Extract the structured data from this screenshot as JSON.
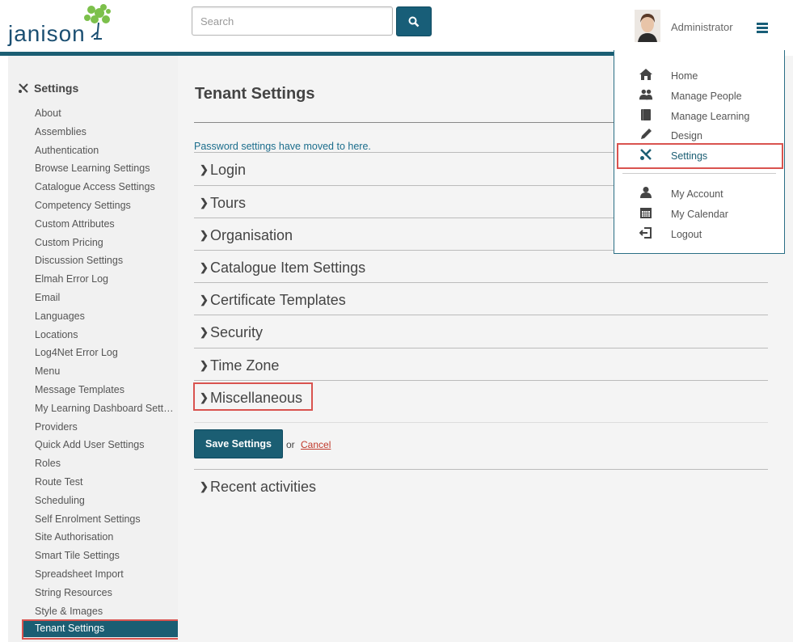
{
  "header": {
    "logo_text": "Janison",
    "search_placeholder": "Search",
    "user_name": "Administrator"
  },
  "sidebar": {
    "title": "Settings",
    "items": [
      "About",
      "Assemblies",
      "Authentication",
      "Browse Learning Settings",
      "Catalogue Access Settings",
      "Competency Settings",
      "Custom Attributes",
      "Custom Pricing",
      "Discussion Settings",
      "Elmah Error Log",
      "Email",
      "Languages",
      "Locations",
      "Log4Net Error Log",
      "Menu",
      "Message Templates",
      "My Learning Dashboard Setti...",
      "Providers",
      "Quick Add User Settings",
      "Roles",
      "Route Test",
      "Scheduling",
      "Self Enrolment Settings",
      "Site Authorisation",
      "Smart Tile Settings",
      "Spreadsheet Import",
      "String Resources",
      "Style & Images"
    ],
    "active_item": "Tenant Settings"
  },
  "main": {
    "title": "Tenant Settings",
    "password_link": "Password settings have moved to here.",
    "sections": [
      "Login",
      "Tours",
      "Organisation",
      "Catalogue Item Settings",
      "Certificate Templates",
      "Security",
      "Time Zone",
      "Miscellaneous"
    ],
    "save_label": "Save Settings",
    "or_text": "or",
    "cancel_label": "Cancel",
    "recent_label": "Recent activities"
  },
  "dropdown": {
    "items": [
      {
        "label": "Home",
        "icon": "home-icon"
      },
      {
        "label": "Manage People",
        "icon": "people-icon"
      },
      {
        "label": "Manage Learning",
        "icon": "book-icon"
      },
      {
        "label": "Design",
        "icon": "pencil-icon"
      },
      {
        "label": "Settings",
        "icon": "tools-icon"
      },
      {
        "label": "My Account",
        "icon": "user-icon"
      },
      {
        "label": "My Calendar",
        "icon": "calendar-icon"
      },
      {
        "label": "Logout",
        "icon": "logout-icon"
      }
    ]
  },
  "colors": {
    "brand": "#1b5e73",
    "highlight": "#d9534f",
    "link": "#1b6d8c",
    "cancel": "#c0392b"
  }
}
